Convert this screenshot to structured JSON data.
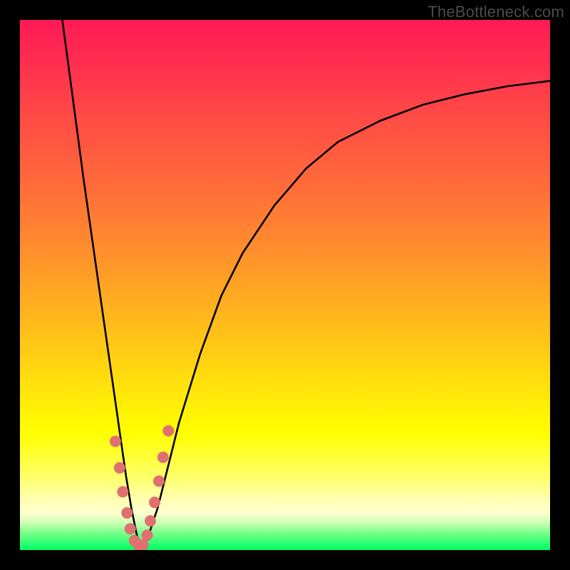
{
  "watermark": "TheBottleneck.com",
  "colors": {
    "curve_stroke": "#000000",
    "dot_fill": "#e07070",
    "dot_stroke": "#c75a5a",
    "frame_bg": "#000000"
  },
  "chart_data": {
    "type": "line",
    "title": "",
    "xlabel": "",
    "ylabel": "",
    "xlim": [
      0,
      100
    ],
    "ylim": [
      0,
      100
    ],
    "grid": false,
    "series": [
      {
        "name": "bottleneck-curve",
        "x": [
          8,
          10,
          12,
          14,
          16,
          18,
          19,
          20,
          21,
          22,
          23,
          24,
          26,
          28,
          30,
          34,
          38,
          42,
          48,
          54,
          60,
          68,
          76,
          84,
          92,
          100
        ],
        "y": [
          100,
          85,
          70,
          56,
          42,
          28,
          21,
          14,
          8,
          3,
          0,
          2,
          8,
          16,
          24,
          37,
          48,
          56,
          65,
          72,
          77,
          81,
          84,
          86,
          87.5,
          88.5
        ]
      }
    ],
    "dots": {
      "name": "highlight-dots",
      "x": [
        18.0,
        18.8,
        19.4,
        20.2,
        20.8,
        21.6,
        22.4,
        23.2,
        24.0,
        24.6,
        25.4,
        26.2,
        27.0,
        28.0
      ],
      "y": [
        20.5,
        15.5,
        11.0,
        7.0,
        4.0,
        1.8,
        0.8,
        1.0,
        2.8,
        5.5,
        9.0,
        13.0,
        17.5,
        22.5
      ]
    }
  }
}
